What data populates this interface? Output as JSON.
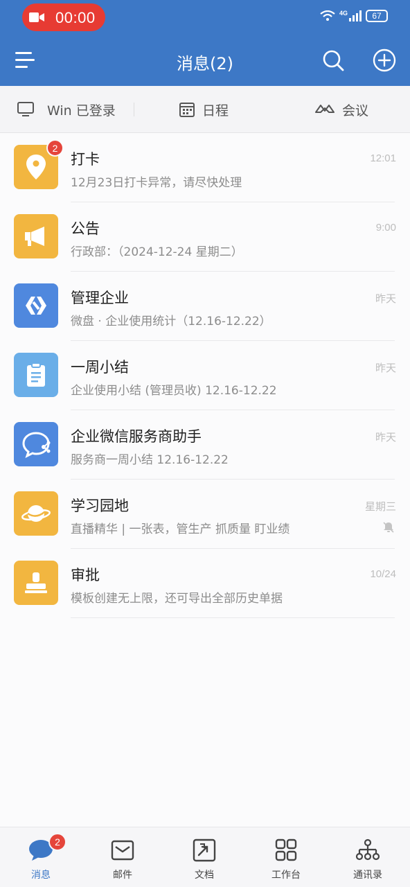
{
  "status_bar": {
    "recording_time": "00:00",
    "network": "4G",
    "battery": "67"
  },
  "header": {
    "title": "消息(2)"
  },
  "quick_bar": {
    "login": "Win 已登录",
    "schedule": "日程",
    "meeting": "会议"
  },
  "messages": [
    {
      "name": "打卡",
      "preview": "12月23日打卡异常，请尽快处理",
      "time": "12:01",
      "badge": "2"
    },
    {
      "name": "公告",
      "preview": "行政部：（2024-12-24 星期二）",
      "time": "9:00"
    },
    {
      "name": "管理企业",
      "preview": "微盘 · 企业使用统计（12.16-12.22）",
      "time": "昨天"
    },
    {
      "name": "一周小结",
      "preview": "企业使用小结 (管理员收) 12.16-12.22",
      "time": "昨天"
    },
    {
      "name": "企业微信服务商助手",
      "preview": "服务商一周小结 12.16-12.22",
      "time": "昨天"
    },
    {
      "name": "学习园地",
      "preview": "直播精华 | 一张表，管生产 抓质量 盯业绩",
      "time": "星期三"
    },
    {
      "name": "审批",
      "preview": "模板创建无上限，还可导出全部历史单据",
      "time": "10/24"
    }
  ],
  "bottom_nav": {
    "messages": "消息",
    "messages_badge": "2",
    "mail": "邮件",
    "docs": "文档",
    "workbench": "工作台",
    "contacts": "通讯录"
  },
  "colors": {
    "primary": "#3d78c6",
    "badge": "#e5453b",
    "recording": "#e73b33"
  }
}
